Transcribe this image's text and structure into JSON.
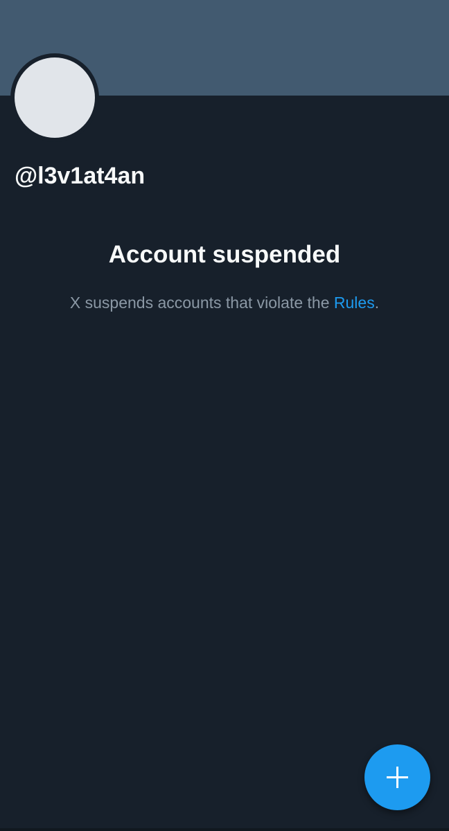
{
  "profile": {
    "handle": "@l3v1at4an",
    "banner_color": "#425a70",
    "avatar_color": "#e1e5ea"
  },
  "suspension": {
    "title": "Account suspended",
    "message_prefix": "X suspends accounts that violate the ",
    "rules_link": "Rules",
    "message_suffix": "."
  },
  "fab": {
    "icon": "plus-icon",
    "color": "#1d9bf0"
  },
  "colors": {
    "background": "#17202b",
    "primary_text": "#f7f9f9",
    "secondary_text": "#8b98a5",
    "link": "#1d9bf0"
  }
}
